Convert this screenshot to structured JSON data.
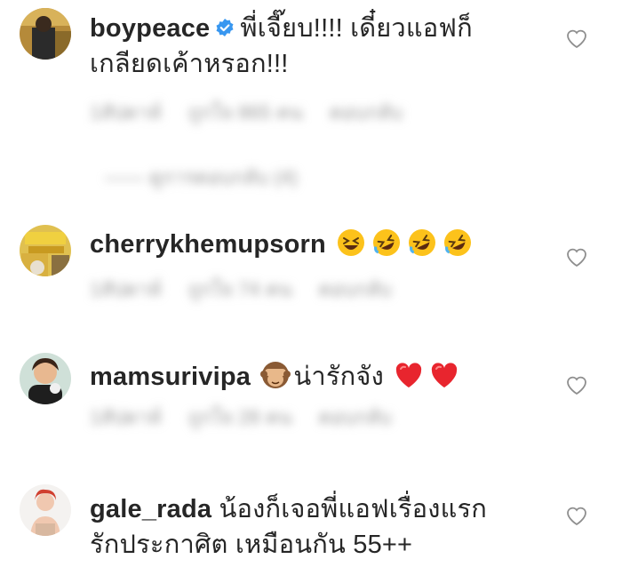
{
  "comments": [
    {
      "username": "boypeace",
      "verified": true,
      "text_line1": "พี่เจี๊ยบ!!!! เดี๋ยวแอฟก็",
      "text_line2": "เกลียดเค้าหรอก!!!",
      "meta": [
        "1สัปดาห์",
        "ถูกใจ 865 คน",
        "ตอบกลับ"
      ],
      "view_replies": "—— ดูการตอบกลับ (4)"
    },
    {
      "username": "cherrykhemupsorn",
      "emojis": [
        "grinning-squinting-face",
        "rolling-on-floor-laughing",
        "rolling-on-floor-laughing",
        "rolling-on-floor-laughing"
      ],
      "meta": [
        "1สัปดาห์",
        "ถูกใจ 74 คน",
        "ตอบกลับ"
      ]
    },
    {
      "username": "mamsurivipa",
      "emoji_before": "see-no-evil-monkey",
      "text": "น่ารักจัง",
      "emojis_after": [
        "red-heart",
        "red-heart"
      ],
      "meta": [
        "1สัปดาห์",
        "ถูกใจ 28 คน",
        "ตอบกลับ"
      ]
    },
    {
      "username": "gale_rada",
      "text_line1": "น้องก็เจอพี่แอฟเรื่องแรก",
      "text_line2": "รักประกาศิต เหมือนกัน 55++"
    }
  ],
  "colors": {
    "verified": "#3897f0",
    "heart_outline": "#8e8e8e",
    "text": "#262626"
  }
}
